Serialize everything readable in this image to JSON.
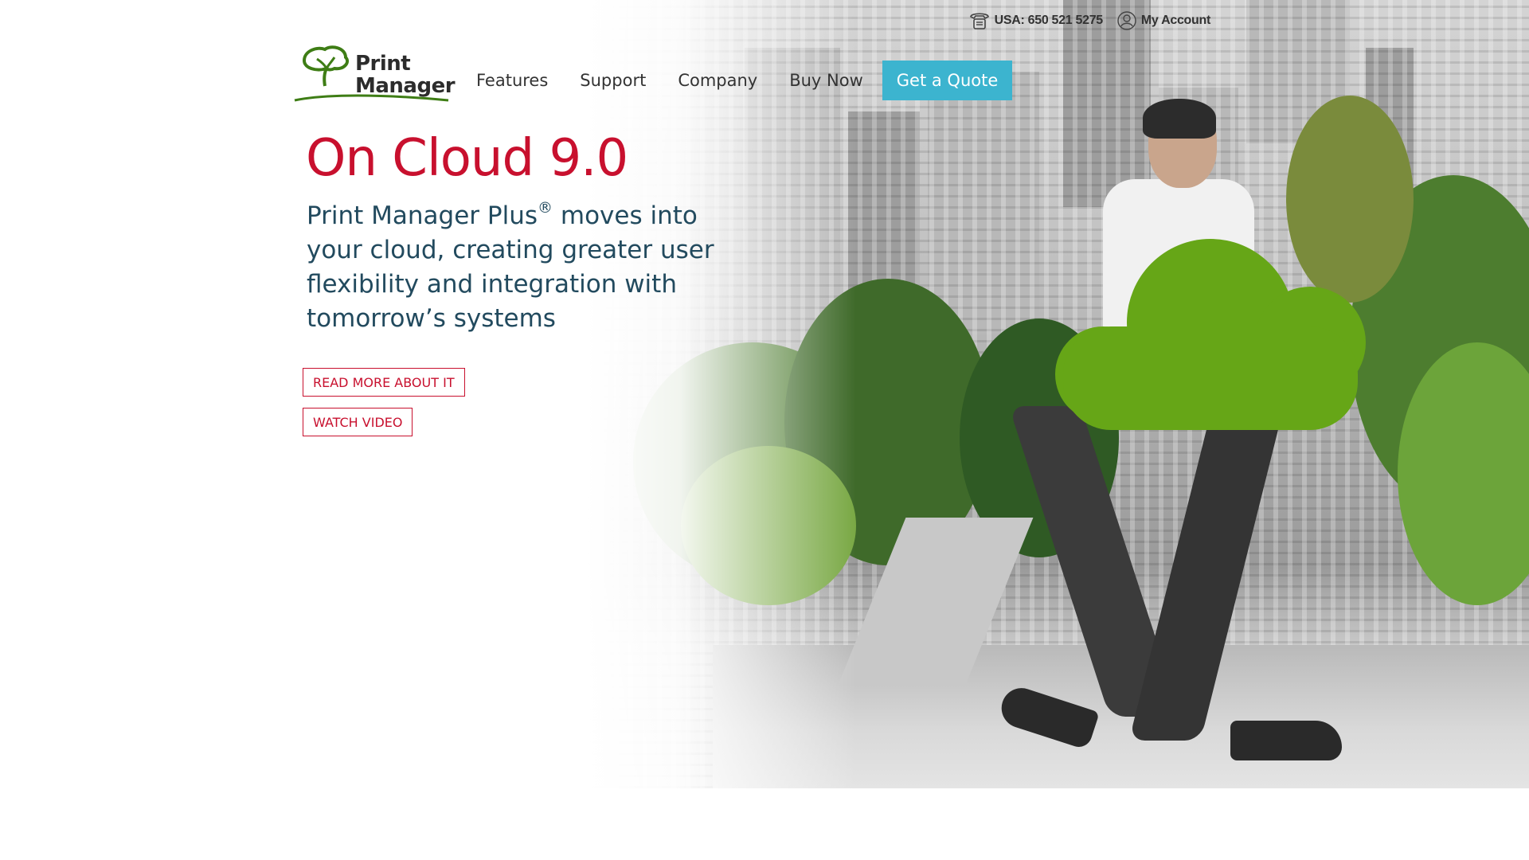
{
  "utility_bar": {
    "phone_label": "USA: 650 521 5275",
    "account_label": "My Account"
  },
  "logo": {
    "line1": "Print",
    "line2": "Manager"
  },
  "nav": {
    "items": [
      "Features",
      "Support",
      "Company",
      "Buy Now"
    ],
    "cta_label": "Get a Quote"
  },
  "hero": {
    "title": "On Cloud 9.0",
    "subtitle_lead": "Print Manager Plus",
    "subtitle_mark": "®",
    "subtitle_rest": " moves into your cloud, creating greater user flexibility and integration with tomorrow’s systems",
    "read_more_label": "READ MORE ABOUT IT",
    "watch_video_label": "WATCH VIDEO"
  },
  "colors": {
    "accent_red": "#c8102e",
    "cta_teal": "#3cb4cf",
    "subtitle_navy": "#224a5e",
    "brand_green": "#66a617"
  },
  "icons": [
    "phone-icon",
    "user-icon",
    "tree-logo-icon"
  ]
}
